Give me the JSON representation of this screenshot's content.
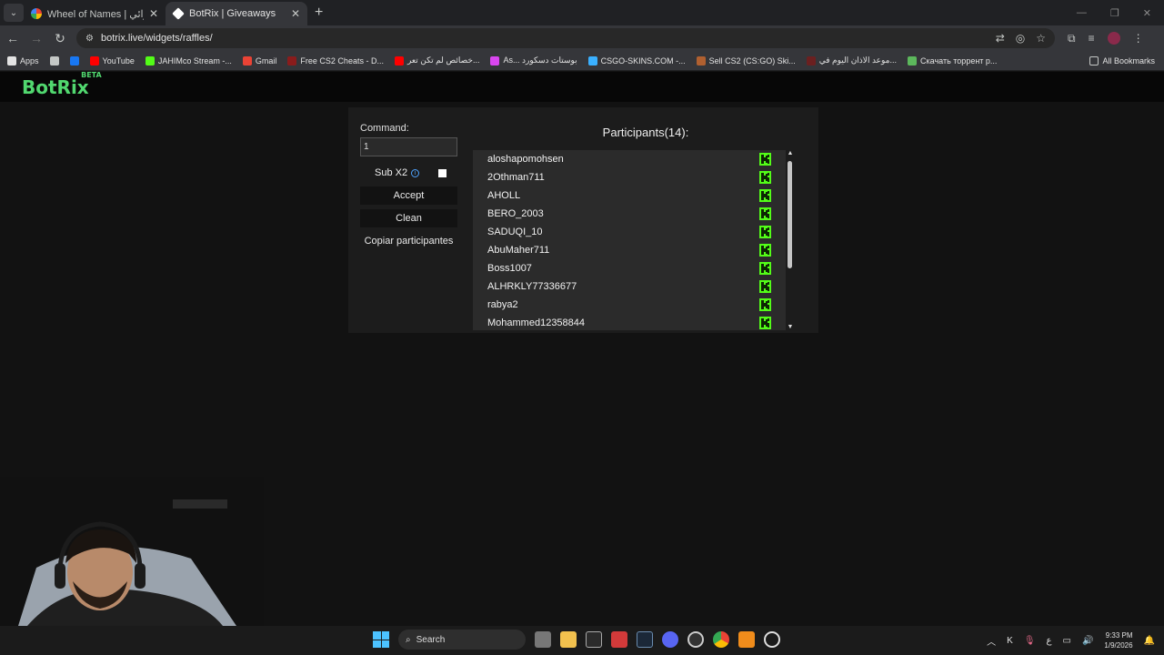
{
  "browser": {
    "tabs": [
      {
        "title": "Wheel of Names | سم العشوائي",
        "active": false,
        "favicon_color": "#4285f4"
      },
      {
        "title": "BotRix | Giveaways",
        "active": true,
        "favicon_color": "#ffffff"
      }
    ],
    "url": "botrix.live/widgets/raffles/",
    "bookmarks": [
      {
        "label": "Apps",
        "icon": "apps-grid-icon",
        "color": "#e3e3e3"
      },
      {
        "label": "",
        "icon": "grid-icon",
        "color": "#c4c7c5"
      },
      {
        "label": "",
        "icon": "facebook-icon",
        "color": "#1877f2"
      },
      {
        "label": "YouTube",
        "icon": "youtube-icon",
        "color": "#ff0000"
      },
      {
        "label": "JAHIMco Stream -...",
        "icon": "kick-icon",
        "color": "#53fc18"
      },
      {
        "label": "Gmail",
        "icon": "gmail-icon",
        "color": "#ea4335"
      },
      {
        "label": "Free CS2 Cheats - D...",
        "icon": "cheats-icon",
        "color": "#8a1c1c"
      },
      {
        "label": "خصائص لم تكن تعر...",
        "icon": "youtube-icon",
        "color": "#ff0000"
      },
      {
        "label": "As... بوستات دسكورد",
        "icon": "gem-icon",
        "color": "#d946ef"
      },
      {
        "label": "CSGO-SKINS.COM -...",
        "icon": "skins-icon",
        "color": "#3ab0ff"
      },
      {
        "label": "Sell CS2 (CS:GO) Ski...",
        "icon": "avatar-icon",
        "color": "#b06030"
      },
      {
        "label": "موعد الاذان اليوم في...",
        "icon": "mosque-icon",
        "color": "#6b2020"
      },
      {
        "label": "Скачать торрент р...",
        "icon": "torrent-icon",
        "color": "#5cb85c"
      }
    ],
    "all_bookmarks": "All Bookmarks"
  },
  "app": {
    "logo": "BotRix",
    "logo_badge": "BETA",
    "command_label": "Command:",
    "command_value": "1",
    "sub_label": "Sub X2",
    "sub_checked": false,
    "accept_label": "Accept",
    "clean_label": "Clean",
    "copy_label": "Copiar participantes",
    "participants_title": "Participants(14):",
    "participants": [
      "aloshapomohsen",
      "2Othman711",
      "AHOLL",
      "BERO_2003",
      "SADUQI_10",
      "AbuMaher711",
      "Boss1007",
      "ALHRKLY77336677",
      "rabya2",
      "Mohammed12358844"
    ],
    "platform_color": "#53fc18"
  },
  "taskbar": {
    "search_label": "Search",
    "time": "9:33 PM",
    "date": "1/9/2026",
    "lang": "ع"
  }
}
